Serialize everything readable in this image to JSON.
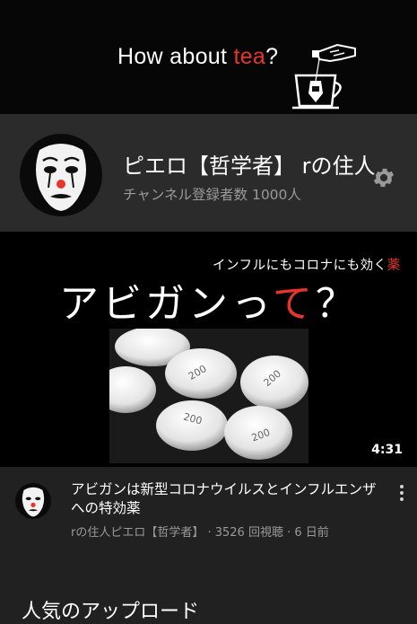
{
  "banner": {
    "title_prefix": "How about ",
    "title_accent": "tea",
    "title_suffix": "?",
    "art": "tea-cup-icon"
  },
  "channel": {
    "name": "ピエロ【哲学者】 rの住人",
    "subscribers": "チャンネル登録者数 1000人",
    "avatar": "pierrot-mask-avatar",
    "settings_icon": "gear-icon"
  },
  "thumbnail": {
    "subtitle_prefix": "インフルにもコロナにも効く",
    "subtitle_accent": "薬",
    "title_prefix": "アビガンっ",
    "title_accent": "て",
    "title_suffix": "？",
    "duration": "4:31",
    "pill_marks": [
      "200",
      "200",
      "200",
      "200"
    ]
  },
  "video": {
    "title": "アビガンは新型コロナウイルスとインフルエンザへの特効薬",
    "meta": "rの住人ピエロ【哲学者】 · 3526 回視聴 · 6 日前",
    "menu_icon": "more-vert-icon"
  },
  "section": {
    "heading": "人気のアップロード"
  },
  "colors": {
    "accent": "#e8352b",
    "background": "#212121",
    "channel_bg": "#2b2b2b",
    "secondary_text": "#9a9a9a"
  }
}
